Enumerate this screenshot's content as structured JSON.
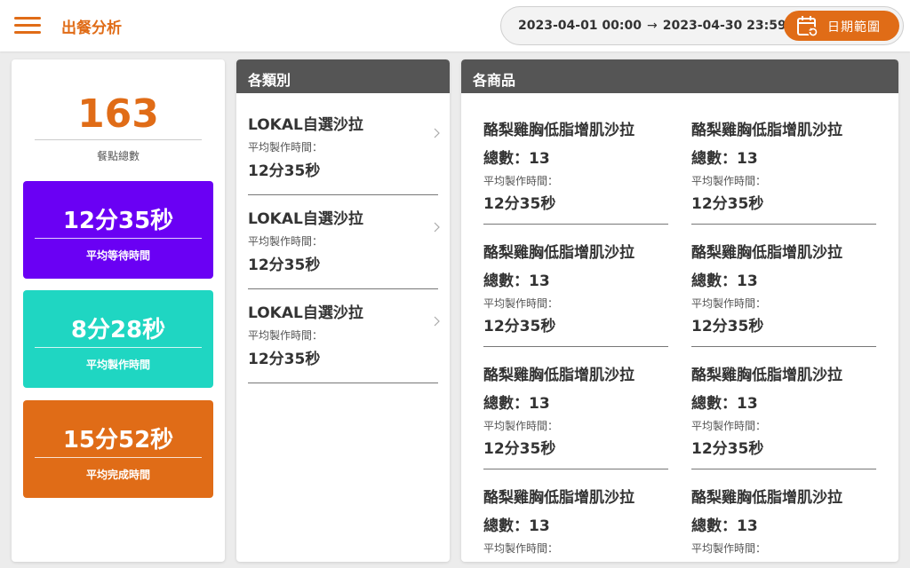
{
  "header": {
    "title": "出餐分析",
    "date_start": "2023-04-01 00:00",
    "arrow": "→",
    "date_end": "2023-04-30 23:59",
    "date_button_label": "日期範圍"
  },
  "colors": {
    "brand": "#e06c17",
    "wait": "#6a00f4",
    "prep": "#1fd6c2",
    "complete": "#e06c17",
    "panel_header": "#555555"
  },
  "summary": {
    "total_orders": "163",
    "total_orders_label": "餐點總數",
    "stats": [
      {
        "value": "12分35秒",
        "label": "平均等待時間"
      },
      {
        "value": "8分28秒",
        "label": "平均製作時間"
      },
      {
        "value": "15分52秒",
        "label": "平均完成時間"
      }
    ]
  },
  "categories": {
    "header": "各類別",
    "items": [
      {
        "name": "LOKAL自選沙拉",
        "sub_label": "平均製作時間：",
        "time": "12分35秒"
      },
      {
        "name": "LOKAL自選沙拉",
        "sub_label": "平均製作時間：",
        "time": "12分35秒"
      },
      {
        "name": "LOKAL自選沙拉",
        "sub_label": "平均製作時間：",
        "time": "12分35秒"
      }
    ]
  },
  "products": {
    "header": "各商品",
    "items": [
      {
        "name": "酪梨雞胸低脂增肌沙拉",
        "count": "總數：13",
        "sub_label": "平均製作時間：",
        "time": "12分35秒"
      },
      {
        "name": "酪梨雞胸低脂增肌沙拉",
        "count": "總數：13",
        "sub_label": "平均製作時間：",
        "time": "12分35秒"
      },
      {
        "name": "酪梨雞胸低脂增肌沙拉",
        "count": "總數：13",
        "sub_label": "平均製作時間：",
        "time": "12分35秒"
      },
      {
        "name": "酪梨雞胸低脂增肌沙拉",
        "count": "總數：13",
        "sub_label": "平均製作時間：",
        "time": "12分35秒"
      },
      {
        "name": "酪梨雞胸低脂增肌沙拉",
        "count": "總數：13",
        "sub_label": "平均製作時間：",
        "time": "12分35秒"
      },
      {
        "name": "酪梨雞胸低脂增肌沙拉",
        "count": "總數：13",
        "sub_label": "平均製作時間：",
        "time": "12分35秒"
      },
      {
        "name": "酪梨雞胸低脂增肌沙拉",
        "count": "總數：13",
        "sub_label": "平均製作時間：",
        "time": ""
      },
      {
        "name": "酪梨雞胸低脂增肌沙拉",
        "count": "總數：13",
        "sub_label": "平均製作時間：",
        "time": ""
      }
    ]
  }
}
